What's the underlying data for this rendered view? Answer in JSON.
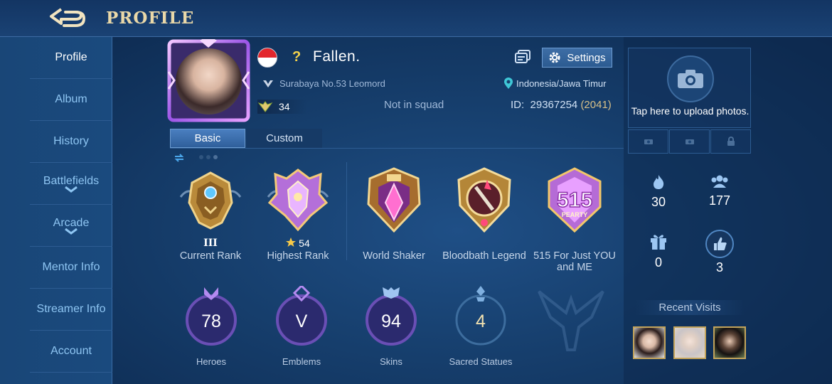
{
  "header": {
    "title": "PROFILE"
  },
  "sidebar": {
    "items": [
      {
        "label": "Profile",
        "active": true
      },
      {
        "label": "Album"
      },
      {
        "label": "History"
      },
      {
        "label": "Battlefields",
        "expandable": true
      },
      {
        "label": "Arcade",
        "expandable": true
      },
      {
        "label": "Mentor Info"
      },
      {
        "label": "Streamer Info"
      },
      {
        "label": "Account"
      }
    ]
  },
  "player": {
    "name": "Fallen.",
    "prefix": "?",
    "flag": "Indonesia",
    "guild": "Surabaya No.53 Leomord",
    "level": "34",
    "squad": "Not in squad",
    "location": "Indonesia/Jawa Timur",
    "id_label": "ID:",
    "id": "29367254",
    "server": "(2041)",
    "settings_label": "Settings"
  },
  "tabs": [
    {
      "label": "Basic",
      "active": true
    },
    {
      "label": "Custom"
    }
  ],
  "badges": [
    {
      "sub": "III",
      "caption": "Current Rank"
    },
    {
      "sub": "54",
      "caption": "Highest Rank"
    },
    {
      "sub": "",
      "caption": "World Shaker"
    },
    {
      "sub": "",
      "caption": "Bloodbath Legend"
    },
    {
      "sub": "",
      "caption": "515 For Just YOU and ME",
      "emblem_text": "515",
      "emblem_sub": "PEARTY"
    }
  ],
  "stats": [
    {
      "value": "78",
      "caption": "Heroes"
    },
    {
      "value": "V",
      "caption": "Emblems"
    },
    {
      "value": "94",
      "caption": "Skins"
    },
    {
      "value": "4",
      "caption": "Sacred Statues"
    }
  ],
  "right": {
    "upload_text": "Tap here to upload photos.",
    "metrics": [
      {
        "icon": "flame-icon",
        "value": "30"
      },
      {
        "icon": "friends-icon",
        "value": "177"
      },
      {
        "icon": "gift-icon",
        "value": "0"
      },
      {
        "icon": "thumbs-up-icon",
        "value": "3"
      }
    ],
    "recent_label": "Recent Visits"
  },
  "colors": {
    "gold": "#e9d8a8",
    "accent": "#8ec5f2",
    "bg": "#17406f"
  }
}
